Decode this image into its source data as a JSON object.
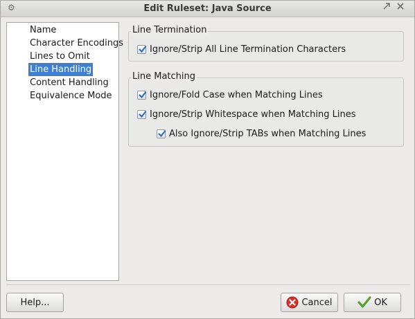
{
  "window": {
    "title": "Edit Ruleset: Java Source",
    "icons": {
      "menu": "gear-icon",
      "maximize": "maximize-icon",
      "close": "close-icon"
    }
  },
  "nav": {
    "items": [
      {
        "label": "Name"
      },
      {
        "label": "Character Encodings"
      },
      {
        "label": "Lines to Omit"
      },
      {
        "label": "Line Handling",
        "selected": true
      },
      {
        "label": "Content Handling"
      },
      {
        "label": "Equivalence Mode"
      }
    ]
  },
  "line_termination": {
    "title": "Line Termination",
    "options": [
      {
        "label": "Ignore/Strip All Line Termination Characters",
        "checked": true
      }
    ]
  },
  "line_matching": {
    "title": "Line Matching",
    "options": [
      {
        "label": "Ignore/Fold Case when Matching Lines",
        "checked": true
      },
      {
        "label": "Ignore/Strip Whitespace when Matching Lines",
        "checked": true
      },
      {
        "label": "Also Ignore/Strip TABs when Matching Lines",
        "checked": true
      }
    ]
  },
  "buttons": {
    "help": "Help...",
    "cancel": "Cancel",
    "ok": "OK"
  },
  "colors": {
    "selection": "#3d7fd1",
    "checkmark": "#2f6fbf",
    "cancel_icon": "#d9302c",
    "ok_icon": "#5aa02c"
  }
}
